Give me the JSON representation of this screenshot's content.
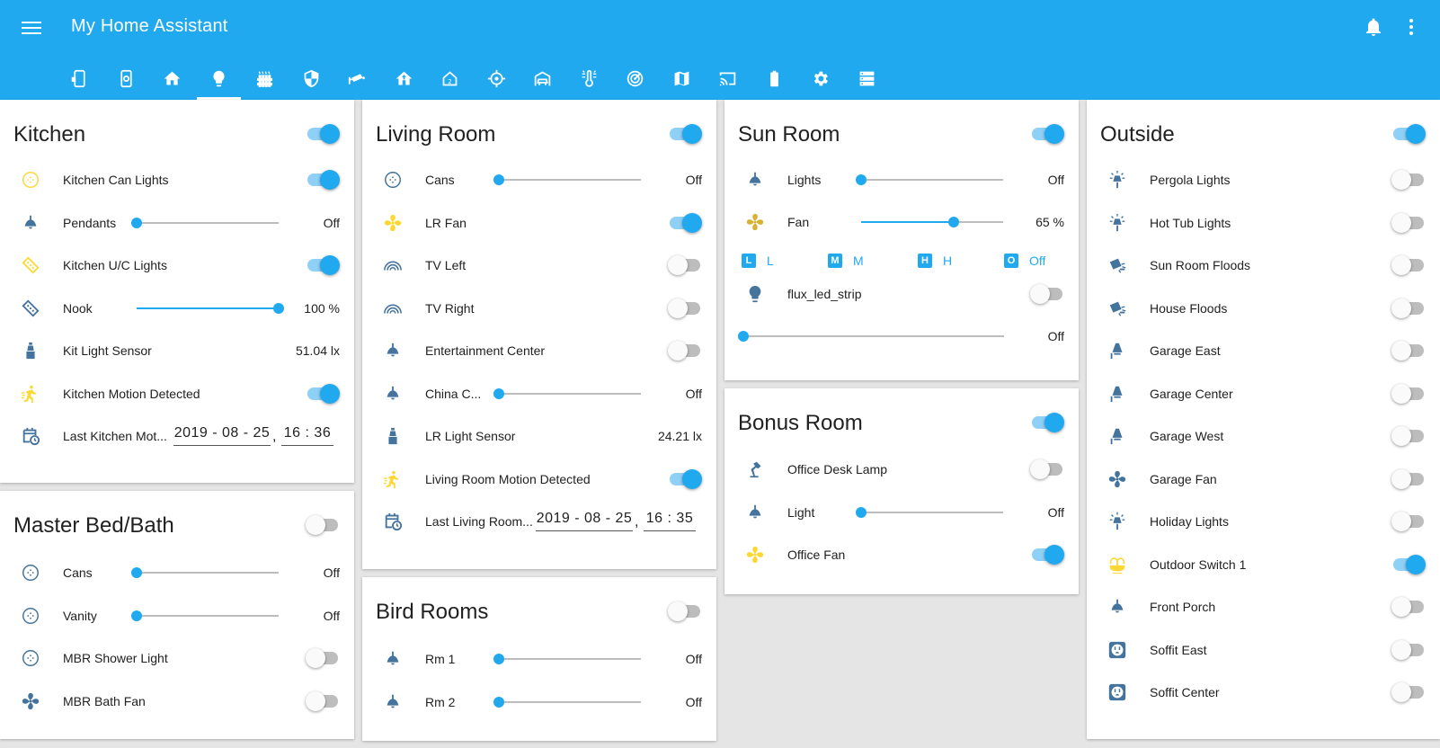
{
  "app": {
    "title": "My Home Assistant",
    "accent": "#21a9f0",
    "header_icons": [
      "menu-icon",
      "bell-icon",
      "more-vertical-icon"
    ]
  },
  "tabs": [
    {
      "icon": "tablet-icon"
    },
    {
      "icon": "tablet-gear-icon"
    },
    {
      "icon": "home-icon"
    },
    {
      "icon": "lightbulb-icon",
      "active": true
    },
    {
      "icon": "radiator-icon"
    },
    {
      "icon": "shield-icon"
    },
    {
      "icon": "cctv-icon"
    },
    {
      "icon": "home-up-icon"
    },
    {
      "icon": "home-2-icon"
    },
    {
      "icon": "crosshairs-icon"
    },
    {
      "icon": "car-garage-icon"
    },
    {
      "icon": "thermometer-lines-icon"
    },
    {
      "icon": "radar-icon"
    },
    {
      "icon": "map-icon"
    },
    {
      "icon": "cast-icon"
    },
    {
      "icon": "battery-icon"
    },
    {
      "icon": "settings-icon"
    },
    {
      "icon": "server-icon"
    }
  ],
  "kitchen": {
    "title": "Kitchen",
    "master_on": true,
    "rows": [
      {
        "name": "Kitchen Can Lights",
        "icon": "recessed-light-icon",
        "on": true
      },
      {
        "name": "Pendants",
        "icon": "ceiling-light-icon",
        "value": "Off",
        "level": 0
      },
      {
        "name": "Kitchen U/C Lights",
        "icon": "led-strip-icon",
        "on": true
      },
      {
        "name": "Nook",
        "icon": "led-strip-icon",
        "value": "100 %",
        "level": 100
      },
      {
        "name": "Kit Light Sensor",
        "icon": "light-sensor-icon",
        "value": "51.04 lx"
      },
      {
        "name": "Kitchen Motion Detected",
        "icon": "motion-sensor-icon",
        "on": true
      },
      {
        "name": "Last Kitchen Mot...",
        "icon": "calendar-clock-icon",
        "date": "2019 - 08 - 25",
        "sep": ",",
        "time": "16 : 36"
      }
    ]
  },
  "master": {
    "title": "Master Bed/Bath",
    "master_on": false,
    "rows": [
      {
        "name": "Cans",
        "icon": "recessed-light-icon",
        "value": "Off",
        "level": 0
      },
      {
        "name": "Vanity",
        "icon": "recessed-light-icon",
        "value": "Off",
        "level": 0
      },
      {
        "name": "MBR Shower Light",
        "icon": "recessed-light-icon",
        "on": false
      },
      {
        "name": "MBR Bath Fan",
        "icon": "fan-icon",
        "on": false
      }
    ]
  },
  "living": {
    "title": "Living Room",
    "master_on": true,
    "rows": [
      {
        "name": "Cans",
        "icon": "recessed-light-icon",
        "value": "Off",
        "level": 0
      },
      {
        "name": "LR Fan",
        "icon": "fan-icon",
        "on": true
      },
      {
        "name": "TV Left",
        "icon": "arc-light-icon",
        "on": false
      },
      {
        "name": "TV Right",
        "icon": "arc-light-icon",
        "on": false
      },
      {
        "name": "Entertainment Center",
        "icon": "ceiling-light-icon",
        "on": false
      },
      {
        "name": "China C...",
        "icon": "ceiling-light-icon",
        "value": "Off",
        "level": 0
      },
      {
        "name": "LR Light Sensor",
        "icon": "light-sensor-icon",
        "value": "24.21 lx"
      },
      {
        "name": "Living Room Motion Detected",
        "icon": "motion-sensor-icon",
        "on": true
      },
      {
        "name": "Last Living Room...",
        "icon": "calendar-clock-icon",
        "date": "2019 - 08 - 25",
        "sep": ",",
        "time": "16 : 35"
      }
    ]
  },
  "bird": {
    "title": "Bird Rooms",
    "master_on": false,
    "rows": [
      {
        "name": "Rm 1",
        "icon": "ceiling-light-icon",
        "value": "Off",
        "level": 0
      },
      {
        "name": "Rm 2",
        "icon": "ceiling-light-icon",
        "value": "Off",
        "level": 0
      }
    ]
  },
  "sun": {
    "title": "Sun Room",
    "master_on": true,
    "lights": {
      "name": "Lights",
      "icon": "ceiling-light-icon",
      "value": "Off",
      "level": 0
    },
    "fan": {
      "name": "Fan",
      "icon": "fan-icon",
      "value": "65 %",
      "level": 65
    },
    "speeds": [
      {
        "badge": "L",
        "label": "L",
        "icon": "letter-l-box-icon"
      },
      {
        "badge": "M",
        "label": "M",
        "icon": "letter-m-box-icon"
      },
      {
        "badge": "H",
        "label": "H",
        "icon": "letter-h-box-icon"
      },
      {
        "badge": "O",
        "label": "Off",
        "icon": "letter-o-box-icon"
      }
    ],
    "flux": {
      "name": "flux_led_strip",
      "icon": "lightbulb-icon",
      "on": false
    },
    "flux_brightness": {
      "value": "Off",
      "level": 0
    }
  },
  "bonus": {
    "title": "Bonus Room",
    "master_on": true,
    "rows": [
      {
        "name": "Office Desk Lamp",
        "icon": "desk-lamp-icon",
        "on": false
      },
      {
        "name": "Light",
        "icon": "ceiling-light-icon",
        "value": "Off",
        "level": 0
      },
      {
        "name": "Office Fan",
        "icon": "fan-icon",
        "on": true
      }
    ]
  },
  "outside": {
    "title": "Outside",
    "master_on": true,
    "rows": [
      {
        "name": "Pergola Lights",
        "icon": "outdoor-lamp-icon",
        "on": false
      },
      {
        "name": "Hot Tub Lights",
        "icon": "outdoor-lamp-icon",
        "on": false
      },
      {
        "name": "Sun Room Floods",
        "icon": "floodlight-icon",
        "on": false
      },
      {
        "name": "House Floods",
        "icon": "floodlight-icon",
        "on": false
      },
      {
        "name": "Garage East",
        "icon": "wall-sconce-icon",
        "on": false
      },
      {
        "name": "Garage Center",
        "icon": "wall-sconce-icon",
        "on": false
      },
      {
        "name": "Garage West",
        "icon": "wall-sconce-icon",
        "on": false
      },
      {
        "name": "Garage Fan",
        "icon": "fan-icon",
        "on": false
      },
      {
        "name": "Holiday Lights",
        "icon": "outdoor-lamp-icon",
        "on": false
      },
      {
        "name": "Outdoor Switch 1",
        "icon": "fountain-icon",
        "on": true
      },
      {
        "name": "Front Porch",
        "icon": "ceiling-light-icon",
        "on": false
      },
      {
        "name": "Soffit East",
        "icon": "power-socket-icon",
        "on": false
      },
      {
        "name": "Soffit Center",
        "icon": "power-socket-icon",
        "on": false
      }
    ]
  },
  "colors": {
    "icon_off": "#44739e",
    "icon_on": "#fdd835",
    "toggle_on": "#21a9f0",
    "toggle_off": "#bdbdbd"
  }
}
